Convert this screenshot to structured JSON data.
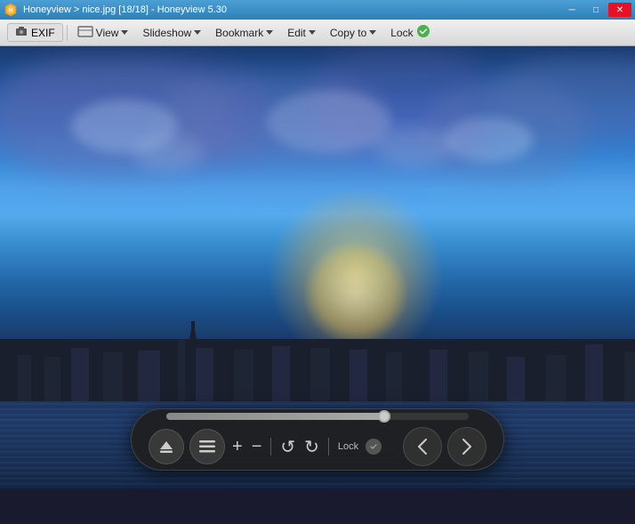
{
  "titlebar": {
    "title": "Honeyview > nice.jpg [18/18] - Honeyview 5.30",
    "min_btn": "─",
    "max_btn": "□",
    "close_btn": "✕"
  },
  "toolbar": {
    "exif_label": "EXIF",
    "view_label": "View",
    "slideshow_label": "Slideshow",
    "bookmark_label": "Bookmark",
    "edit_label": "Edit",
    "copyto_label": "Copy to",
    "lock_label": "Lock"
  },
  "controls": {
    "zoom_in": "+",
    "zoom_out": "−",
    "rotate_left": "↺",
    "rotate_right": "↻",
    "lock_label": "Lock",
    "prev_label": "❮",
    "next_label": "❯"
  },
  "image": {
    "filename": "nice.jpg",
    "index": "18",
    "total": "18"
  }
}
